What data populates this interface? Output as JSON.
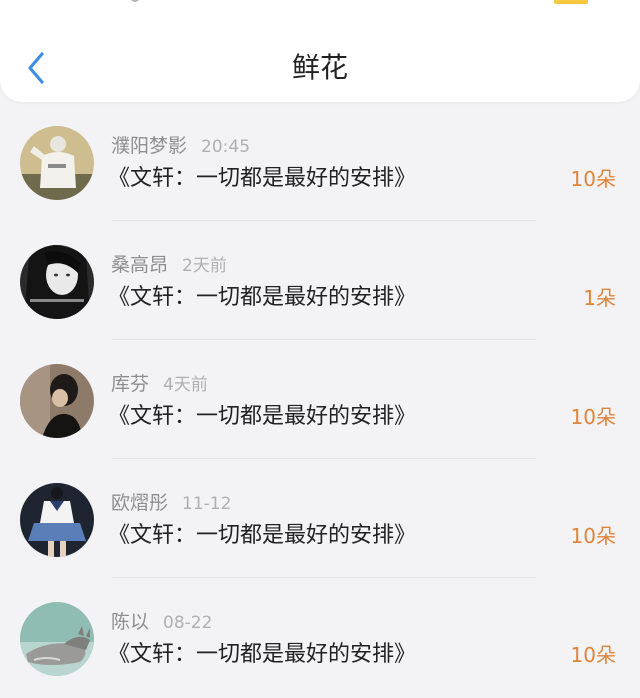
{
  "header": {
    "title": "鲜花"
  },
  "colors": {
    "accent_back": "#3d8fe6",
    "amount": "#e0843a"
  },
  "rows": [
    {
      "name": "濮阳梦影",
      "time": "20:45",
      "book": "《文轩：一切都是最好的安排》",
      "amount": "10朵",
      "avatar": "avatar-figure-white-clothes"
    },
    {
      "name": "桑高昂",
      "time": "2天前",
      "book": "《文轩：一切都是最好的安排》",
      "amount": "1朵",
      "avatar": "avatar-bw-girl"
    },
    {
      "name": "库芬",
      "time": "4天前",
      "book": "《文轩：一切都是最好的安排》",
      "amount": "10朵",
      "avatar": "avatar-dark-hair-girl"
    },
    {
      "name": "欧熠彤",
      "time": "11-12",
      "book": "《文轩：一切都是最好的安排》",
      "amount": "10朵",
      "avatar": "avatar-sailor-uniform"
    },
    {
      "name": "陈以",
      "time": "08-22",
      "book": "《文轩：一切都是最好的安排》",
      "amount": "10朵",
      "avatar": "avatar-cat"
    }
  ]
}
